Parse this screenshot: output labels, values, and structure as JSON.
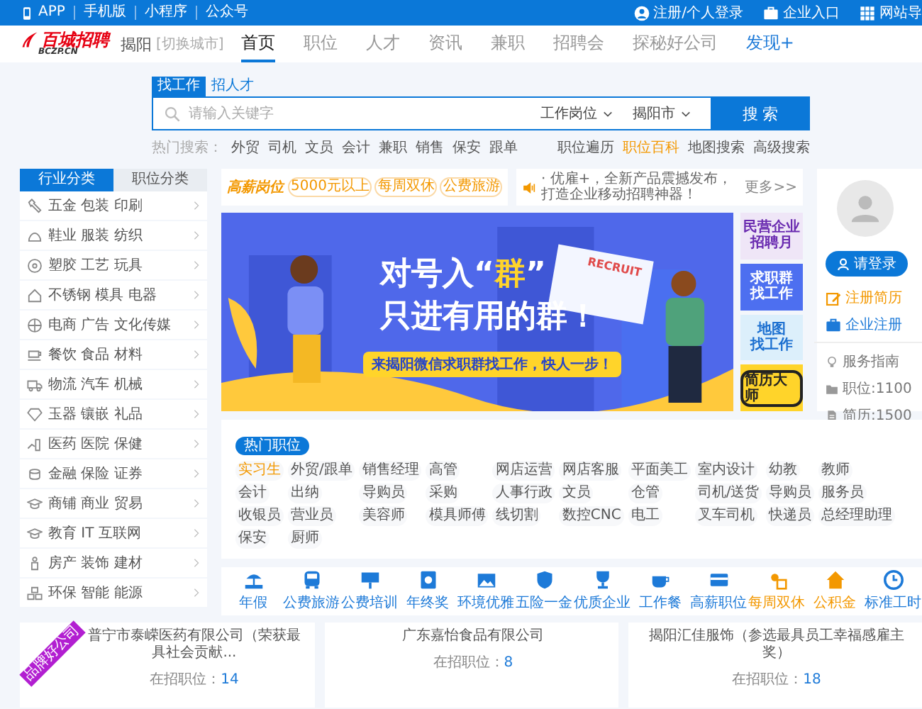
{
  "top_bar": {
    "links": [
      "APP",
      "手机版",
      "小程序",
      "公众号"
    ],
    "right_links": [
      {
        "label": "注册/个人登录",
        "kind": "user"
      },
      {
        "label": "企业入口",
        "kind": "case"
      },
      {
        "label": "网站导",
        "kind": "grid"
      }
    ]
  },
  "header": {
    "logo": "百城招聘",
    "logo_sub": "BCZP.CN",
    "city": "揭阳",
    "switch_city": "[切换城市]",
    "nav": [
      {
        "label": "首页",
        "selected": true,
        "kind": "normal"
      },
      {
        "label": "职位",
        "selected": false,
        "kind": "normal"
      },
      {
        "label": "人才",
        "selected": false,
        "kind": "normal"
      },
      {
        "label": "资讯",
        "selected": false,
        "kind": "normal"
      },
      {
        "label": "兼职",
        "selected": false,
        "kind": "normal"
      },
      {
        "label": "招聘会",
        "selected": false,
        "kind": "normal"
      },
      {
        "label": "探秘好公司",
        "selected": false,
        "kind": "normal"
      },
      {
        "label": "发现+",
        "selected": false,
        "kind": "highlight"
      }
    ]
  },
  "search": {
    "tabs": [
      {
        "label": "找工作",
        "selected": true
      },
      {
        "label": "招人才",
        "selected": false
      }
    ],
    "placeholder": "请输入关键字",
    "dropdowns": [
      "工作岗位",
      "揭阳市"
    ],
    "button": "搜 索",
    "hot_label": "热门搜索：",
    "hot": [
      "外贸",
      "司机",
      "文员",
      "会计",
      "兼职",
      "销售",
      "保安",
      "跟单"
    ],
    "links": [
      {
        "label": "职位遍历",
        "highlight": false
      },
      {
        "label": "职位百科",
        "highlight": true
      },
      {
        "label": "地图搜索",
        "highlight": false
      },
      {
        "label": "高级搜索",
        "highlight": false
      }
    ]
  },
  "categories": {
    "tabs": [
      {
        "label": "行业分类",
        "selected": true
      },
      {
        "label": "职位分类",
        "selected": false
      }
    ],
    "items": [
      "五金 包装 印刷",
      "鞋业 服装 纺织",
      "塑胶 工艺 玩具",
      "不锈钢 模具 电器",
      "电商 广告 文化传媒",
      "餐饮 食品 材料",
      "物流 汽车 机械",
      "玉器 镶嵌 礼品",
      "医药 医院 保健",
      "金融 保险 证券",
      "商铺 商业 贸易",
      "教育 IT 互联网",
      "房产 装饰 建材",
      "环保 智能 能源"
    ]
  },
  "promo": {
    "logo": "高薪岗位",
    "tags": [
      "5000元以上",
      "每周双休",
      "公费旅游"
    ]
  },
  "notice": {
    "text": "· 优雇+，全新产品震撼发布，打造企业移动招聘神器！",
    "more": "更多>>"
  },
  "banner": {
    "kind": "picture",
    "headline_1": [
      {
        "text": "对号入“",
        "highlight": false
      },
      {
        "text": "群",
        "highlight": true
      },
      {
        "text": "”",
        "highlight": false
      }
    ],
    "headline_2": "只进有用的群！",
    "sign": "RECRUIT",
    "strap": "来揭阳微信求职群找工作，快人一步！"
  },
  "side_ads": [
    {
      "lines": [
        "民营企业",
        "招聘月"
      ],
      "color": "#efe6f7",
      "kind": "purple"
    },
    {
      "lines": [
        "求职群",
        "找工作"
      ],
      "color": "#4d6ff0",
      "kind": "white"
    },
    {
      "lines": [
        "地图",
        "找工作"
      ],
      "color": "#dceffb",
      "kind": "blue"
    },
    {
      "lines": [
        "简历大师"
      ],
      "color": "#ffd42a",
      "kind": "pill"
    }
  ],
  "user_panel": {
    "login": "请登录",
    "links": [
      {
        "label": "注册简历",
        "kind": "edit"
      },
      {
        "label": "企业注册",
        "kind": "case"
      }
    ],
    "info": [
      {
        "label": "服务指南",
        "kind": "bulb"
      },
      {
        "label": "职位:1100",
        "kind": "folder"
      },
      {
        "label": "简历:1500",
        "kind": "doc"
      }
    ]
  },
  "hot_jobs": {
    "badge": "热门职位",
    "jobs": [
      {
        "label": "实习生",
        "highlight": true
      },
      {
        "label": "外贸/跟单",
        "highlight": false
      },
      {
        "label": "销售经理",
        "highlight": false
      },
      {
        "label": "高管",
        "highlight": false
      },
      {
        "label": "网店运营",
        "highlight": false
      },
      {
        "label": "网店客服",
        "highlight": false
      },
      {
        "label": "平面美工",
        "highlight": false
      },
      {
        "label": "室内设计",
        "highlight": false
      },
      {
        "label": "幼教",
        "highlight": false
      },
      {
        "label": "教师",
        "highlight": false
      },
      {
        "label": "会计",
        "highlight": false
      },
      {
        "label": "出纳",
        "highlight": false
      },
      {
        "label": "导购员",
        "highlight": false
      },
      {
        "label": "采购",
        "highlight": false
      },
      {
        "label": "人事行政",
        "highlight": false
      },
      {
        "label": "文员",
        "highlight": false
      },
      {
        "label": "仓管",
        "highlight": false
      },
      {
        "label": "司机/送货",
        "highlight": false
      },
      {
        "label": "导购员",
        "highlight": false
      },
      {
        "label": "服务员",
        "highlight": false
      },
      {
        "label": "收银员",
        "highlight": false
      },
      {
        "label": "营业员",
        "highlight": false
      },
      {
        "label": "美容师",
        "highlight": false
      },
      {
        "label": "模具师傅",
        "highlight": false
      },
      {
        "label": "线切割",
        "highlight": false
      },
      {
        "label": "数控CNC",
        "highlight": false
      },
      {
        "label": "电工",
        "highlight": false
      },
      {
        "label": "叉车司机",
        "highlight": false
      },
      {
        "label": "快递员",
        "highlight": false
      },
      {
        "label": "总经理助理",
        "highlight": false
      },
      {
        "label": "保安",
        "highlight": false
      },
      {
        "label": "厨师",
        "highlight": false
      }
    ]
  },
  "benefits": [
    {
      "label": "年假",
      "color": "#1d7ad8"
    },
    {
      "label": "公费旅游",
      "color": "#1d7ad8"
    },
    {
      "label": "公费培训",
      "color": "#1d7ad8"
    },
    {
      "label": "年终奖",
      "color": "#1d7ad8"
    },
    {
      "label": "环境优雅",
      "color": "#1d7ad8"
    },
    {
      "label": "五险一金",
      "color": "#1d7ad8"
    },
    {
      "label": "优质企业",
      "color": "#1d7ad8"
    },
    {
      "label": "工作餐",
      "color": "#1d7ad8"
    },
    {
      "label": "高薪职位",
      "color": "#1d7ad8"
    },
    {
      "label": "每周双休",
      "color": "#f39800"
    },
    {
      "label": "公积金",
      "color": "#f39800"
    },
    {
      "label": "标准工时",
      "color": "#1d7ad8"
    }
  ],
  "companies": [
    {
      "name": "普宁市泰嵘医药有限公司（荣获最具社会贡献...",
      "count_label": "在招职位：",
      "count": "14",
      "ribbon": "品牌好公司"
    },
    {
      "name": "广东嘉怡食品有限公司",
      "count_label": "在招职位：",
      "count": "8"
    },
    {
      "name": "揭阳汇佳服饰（参选最具员工幸福感雇主奖）",
      "count_label": "在招职位：",
      "count": "18"
    }
  ]
}
